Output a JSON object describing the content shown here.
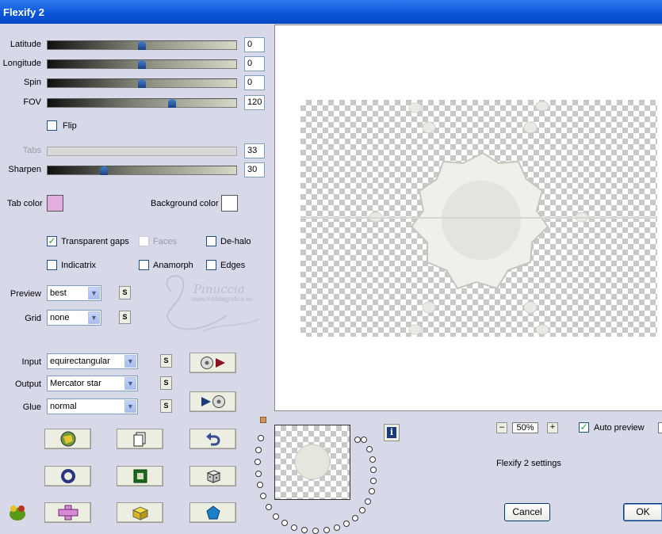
{
  "window": {
    "title": "Flexify 2"
  },
  "sliders": [
    {
      "label": "Latitude",
      "value": "0",
      "position": 0.5
    },
    {
      "label": "Longitude",
      "value": "0",
      "position": 0.5
    },
    {
      "label": "Spin",
      "value": "0",
      "position": 0.5
    },
    {
      "label": "FOV",
      "value": "120",
      "position": 0.66
    },
    {
      "label": "Tabs",
      "value": "33",
      "position": null,
      "disabled": true
    },
    {
      "label": "Sharpen",
      "value": "30",
      "position": 0.3
    }
  ],
  "flip": {
    "label": "Flip",
    "checked": false
  },
  "colors": {
    "tab_label": "Tab color",
    "tab_color": "#e2aee0",
    "bg_label": "Background color",
    "bg_color": "#ffffff"
  },
  "options": {
    "transparent_gaps": {
      "label": "Transparent gaps",
      "checked": true
    },
    "faces": {
      "label": "Faces",
      "checked": false,
      "disabled": true
    },
    "de_halo": {
      "label": "De-halo",
      "checked": false
    },
    "indicatrix": {
      "label": "Indicatrix",
      "checked": false
    },
    "anamorph": {
      "label": "Anamorph",
      "checked": false
    },
    "edges": {
      "label": "Edges",
      "checked": false
    }
  },
  "selects": {
    "preview": {
      "label": "Preview",
      "value": "best"
    },
    "grid": {
      "label": "Grid",
      "value": "none"
    },
    "input": {
      "label": "Input",
      "value": "equirectangular"
    },
    "output": {
      "label": "Output",
      "value": "Mercator star"
    },
    "glue": {
      "label": "Glue",
      "value": "normal"
    }
  },
  "small_button_label": "S",
  "watermark": {
    "name": "Pinuccia",
    "url": "www.malidagrafica.eu"
  },
  "zoom": {
    "value": "50%",
    "minus": "–",
    "plus": "+"
  },
  "auto_preview": {
    "label": "Auto preview",
    "checked": true
  },
  "settings_text": "Flexify 2 settings",
  "buttons": {
    "cancel": "Cancel",
    "ok": "OK"
  },
  "icons": {
    "info": "info-icon",
    "colors": {
      "check": "#21a121",
      "accent": "#0a55d8"
    }
  }
}
